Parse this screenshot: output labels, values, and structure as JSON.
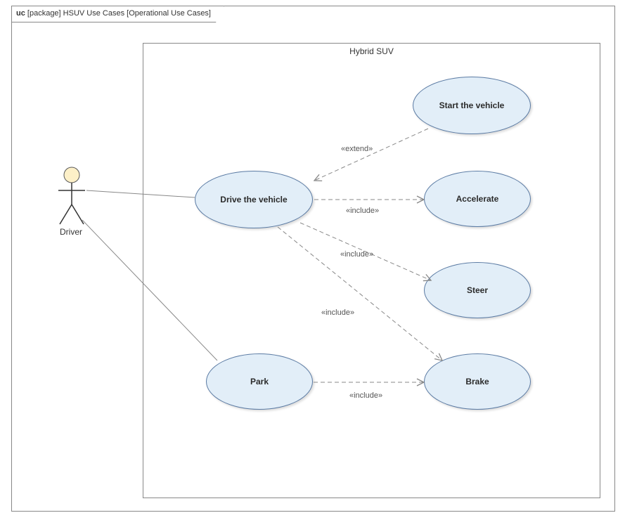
{
  "frame": {
    "kind": "uc",
    "package_label": "[package]",
    "title": "HSUV Use Cases",
    "subtitle": "[Operational Use Cases]"
  },
  "subject": {
    "name": "Hybrid SUV"
  },
  "actor": {
    "name": "Driver"
  },
  "usecases": {
    "start": {
      "label": "Start the vehicle"
    },
    "drive": {
      "label": "Drive the vehicle"
    },
    "accelerate": {
      "label": "Accelerate"
    },
    "steer": {
      "label": "Steer"
    },
    "brake": {
      "label": "Brake"
    },
    "park": {
      "label": "Park"
    }
  },
  "relations": {
    "start_drive": {
      "stereotype": "«extend»"
    },
    "drive_accelerate": {
      "stereotype": "«include»"
    },
    "drive_steer": {
      "stereotype": "«include»"
    },
    "drive_brake": {
      "stereotype": "«include»"
    },
    "park_brake": {
      "stereotype": "«include»"
    }
  }
}
